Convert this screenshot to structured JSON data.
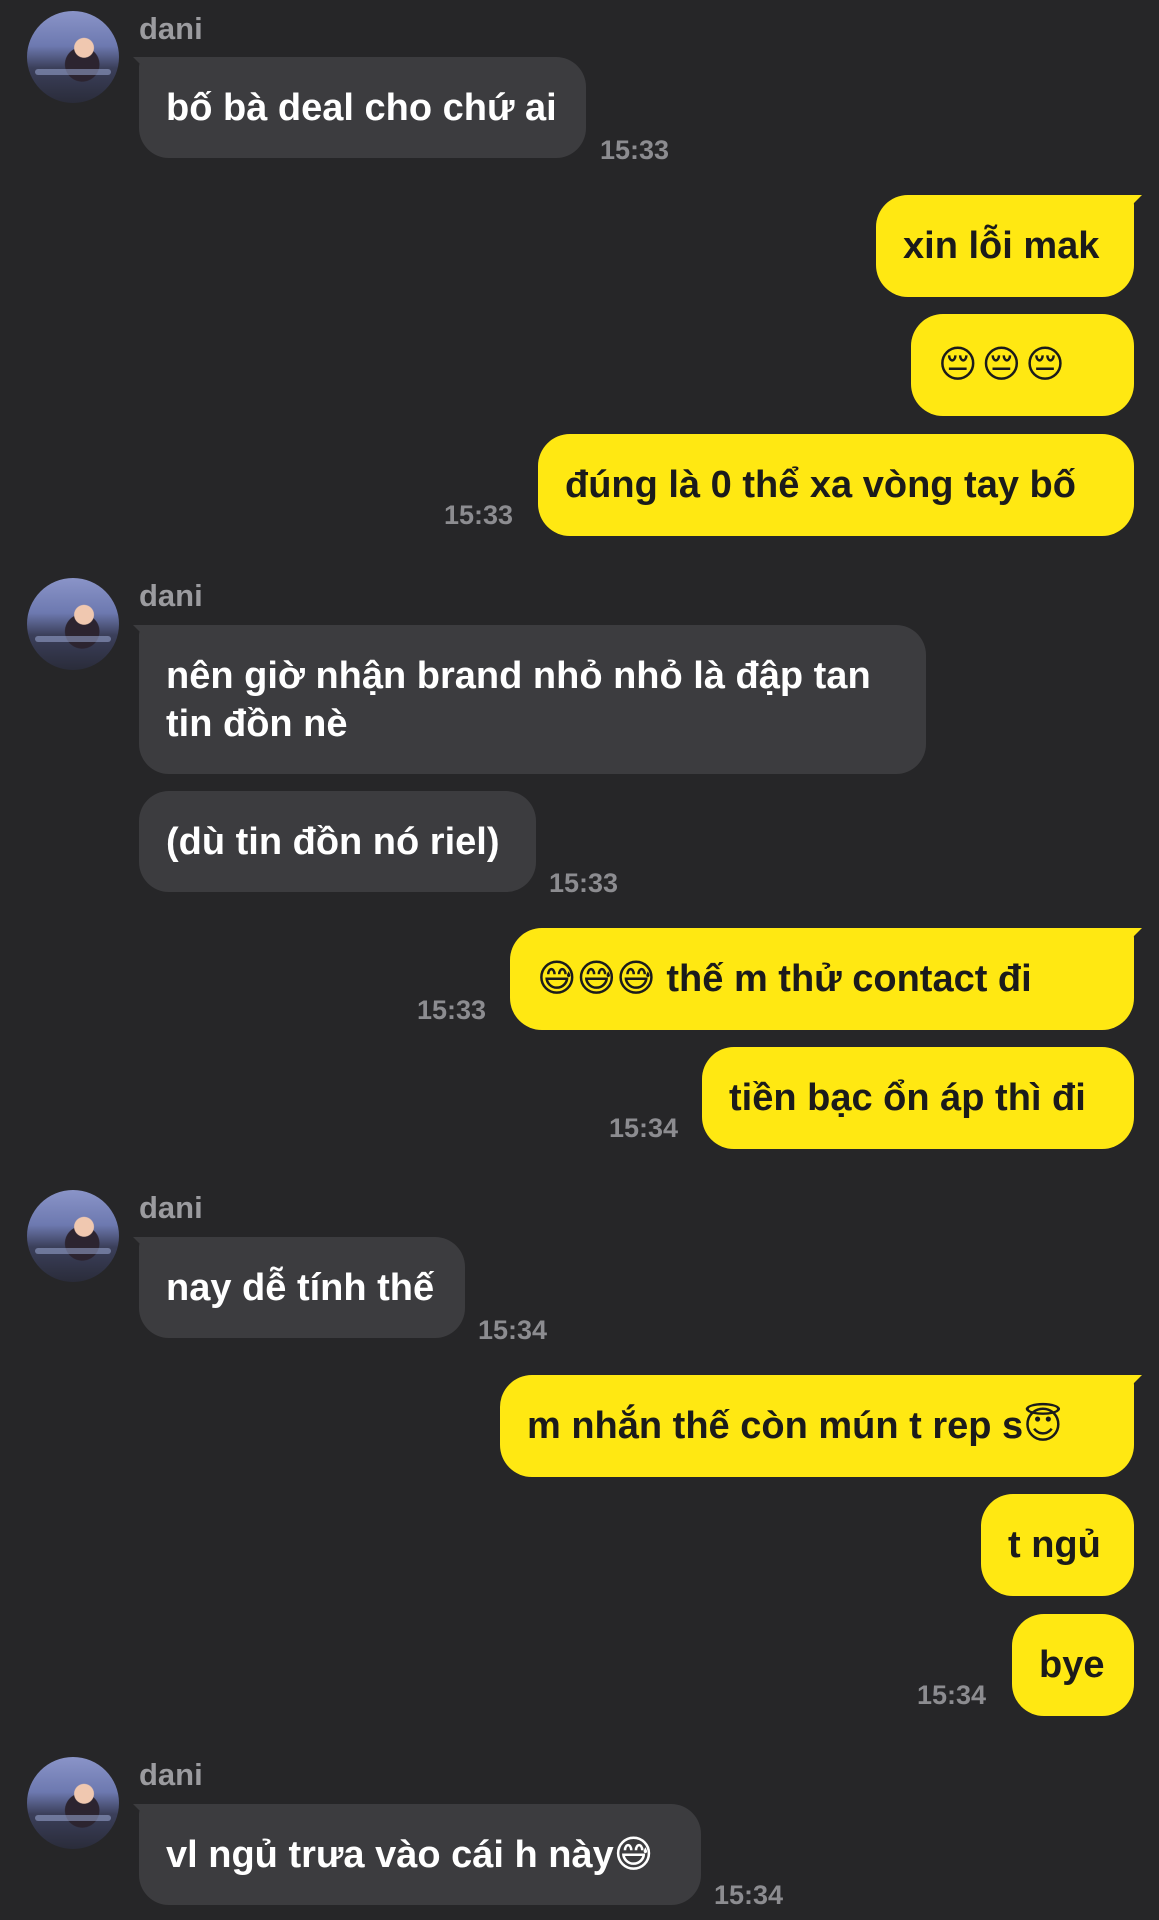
{
  "chat": {
    "contact": "dani",
    "items": [
      {
        "sender": "dani",
        "text": "bố bà deal cho chứ ai",
        "time": "15:33"
      },
      {
        "text": "xin lỗi mak"
      },
      {
        "text": "😔😔😔"
      },
      {
        "text": "đúng là 0 thể xa vòng tay bố",
        "time": "15:33"
      },
      {
        "sender": "dani",
        "text": "nên giờ nhận brand nhỏ nhỏ là đập tan tin đồn nè"
      },
      {
        "text": "(dù tin đồn nó riel)",
        "time": "15:33"
      },
      {
        "text": "😅😅😅 thế m thử contact đi",
        "time": "15:33"
      },
      {
        "text": "tiền bạc ổn áp thì đi",
        "time": "15:34"
      },
      {
        "sender": "dani",
        "text": "nay dễ tính thế",
        "time": "15:34"
      },
      {
        "text": "m nhắn thế còn mún t rep s😇"
      },
      {
        "text": "t ngủ"
      },
      {
        "text": "bye",
        "time": "15:34"
      },
      {
        "sender": "dani",
        "text": "vl ngủ trưa vào cái h này😅",
        "time": "15:34"
      }
    ]
  },
  "colors": {
    "background": "#262628",
    "incoming_bubble": "#3c3c3f",
    "outgoing_bubble": "#ffe812",
    "timestamp": "#8c8c90",
    "sender_name": "#9b9b9f"
  }
}
